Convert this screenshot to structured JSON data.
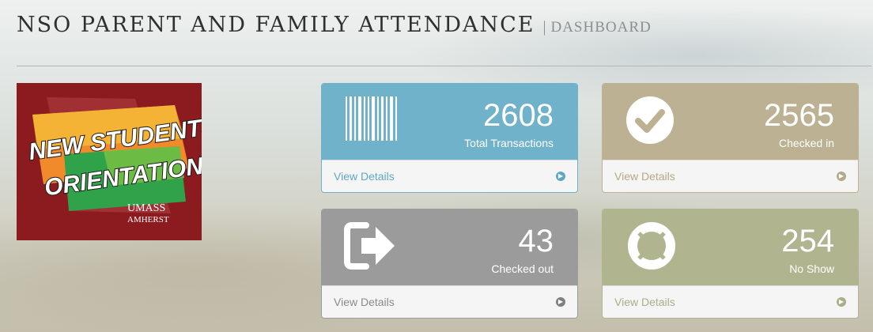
{
  "header": {
    "title": "NSO PARENT AND FAMILY ATTENDANCE",
    "separator": "|",
    "subtitle": "DASHBOARD"
  },
  "logo": {
    "line1": "NEW STUDENTS",
    "line2": "ORIENTATION",
    "org_line1": "UMASS",
    "org_line2": "AMHERST"
  },
  "panels": [
    {
      "value": "2608",
      "label": "Total Transactions",
      "details": "View Details",
      "icon": "barcode-icon",
      "color": "#71b2cb"
    },
    {
      "value": "2565",
      "label": "Checked in",
      "details": "View Details",
      "icon": "check-circle-icon",
      "color": "#bcb293"
    },
    {
      "value": "43",
      "label": "Checked out",
      "details": "View Details",
      "icon": "sign-out-icon",
      "color": "#9b9b9b"
    },
    {
      "value": "254",
      "label": "No Show",
      "details": "View Details",
      "icon": "life-ring-icon",
      "color": "#b0b58f"
    }
  ]
}
